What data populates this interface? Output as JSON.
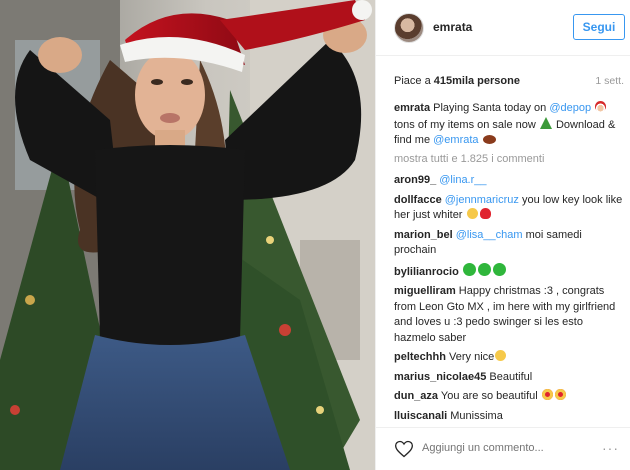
{
  "post": {
    "username": "emrata",
    "follow_label": "Segui",
    "likes_prefix": "Piace a ",
    "likes_count": "415mila persone",
    "time": "1 sett.",
    "show_all": "mostra tutti e 1.825 i commenti",
    "add_comment_placeholder": "Aggiungi un commento...",
    "more_label": "···"
  },
  "caption": {
    "user": "emrata",
    "t1": " Playing Santa today on ",
    "m1": "@depop",
    "t2": " tons of my items on sale now ",
    "t3": " Download & find me ",
    "m2": "@emrata"
  },
  "comments": [
    {
      "user": "aron99_",
      "mention": "@lina.r__",
      "text": ""
    },
    {
      "user": "dollfacce",
      "mention": "@jennmaricruz",
      "text": " you low key look like her just whiter"
    },
    {
      "user": "marion_bel",
      "mention": "@lisa__cham",
      "text": " moi samedi prochain"
    },
    {
      "user": "bylilianrocio",
      "mention": "",
      "text": " "
    },
    {
      "user": "miguelliram",
      "mention": "",
      "text": " Happy christmas :3 , congrats from Leon Gto MX , im here with my girlfriend and loves u :3 pedo swinger si les esto hazmelo saber"
    },
    {
      "user": "peltechhh",
      "mention": "",
      "text": " Very nice"
    },
    {
      "user": "marius_nicolae45",
      "mention": "",
      "text": " Beautiful"
    },
    {
      "user": "dun_aza",
      "mention": "",
      "text": " You are so beautiful"
    },
    {
      "user": "lluiscanali",
      "mention": "",
      "text": " Munissima"
    }
  ],
  "icons": {
    "santa": "santa-emoji-icon",
    "tree": "christmas-tree-emoji-icon",
    "football": "football-emoji-icon",
    "heart_red": "red-heart-emoji-icon",
    "green_heart": "green-heart-emoji-icon",
    "grin": "grinning-emoji-icon",
    "heart_eyes": "heart-eyes-emoji-icon"
  },
  "colors": {
    "link": "#3897f0",
    "muted": "#999999",
    "text": "#262626",
    "border": "#efefef"
  }
}
